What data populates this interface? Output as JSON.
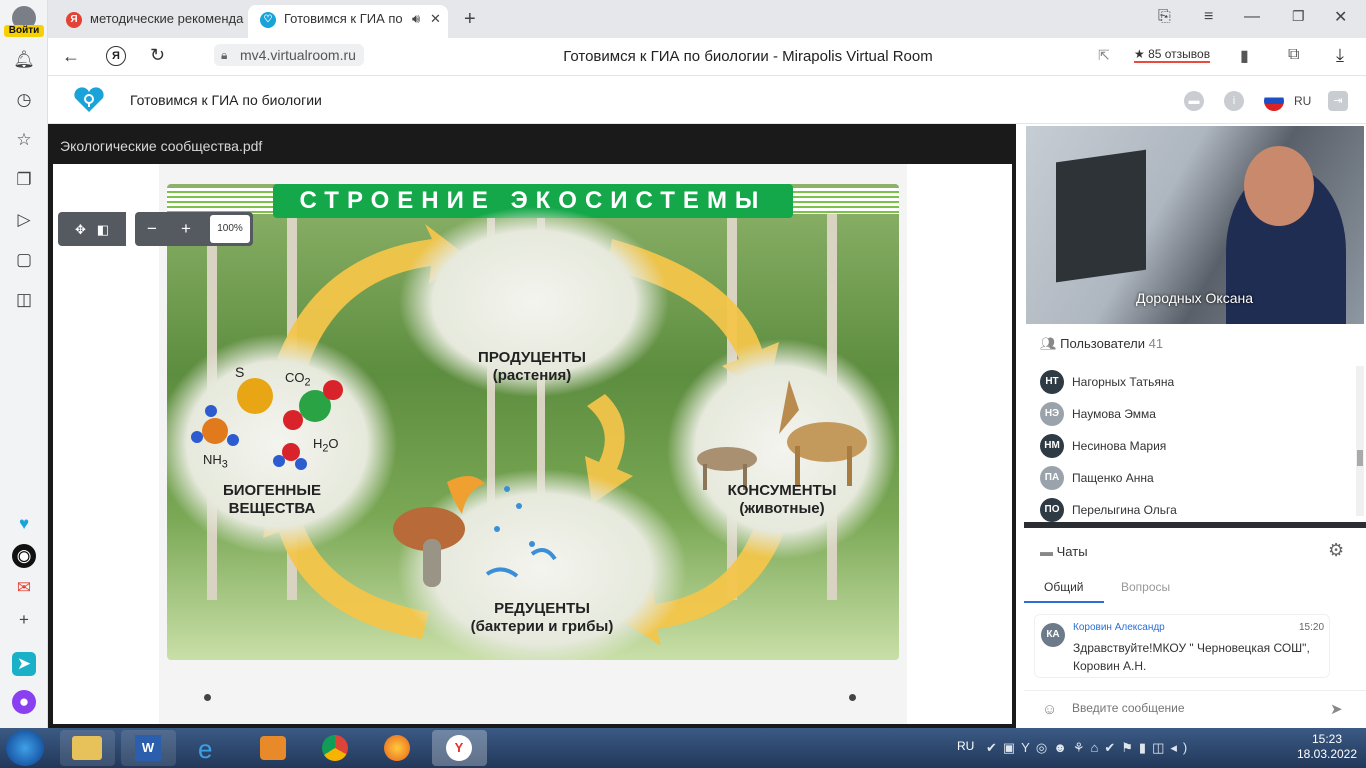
{
  "browser": {
    "login_label": "Войти",
    "tabs": [
      {
        "title": "методические рекоменда",
        "fav": "Я",
        "fav_color": "#e34234"
      },
      {
        "title": "Готовимся к ГИА по",
        "fav": "♡",
        "fav_color": "#1aa3d9"
      }
    ],
    "url": "mv4.virtualroom.ru",
    "page_title": "Готовимся к ГИА по биологии - Mirapolis Virtual Room",
    "reviews": "★ 85 отзывов"
  },
  "app": {
    "title": "Готовимся к ГИА по биологии",
    "lang": "RU"
  },
  "presentation": {
    "file_name": "Экологические сообщества.pdf",
    "zoom": "100%",
    "slide": {
      "title": "СТРОЕНИЕ ЭКОСИСТЕМЫ",
      "producers": "ПРОДУЦЕНТЫ",
      "producers_sub": "(растения)",
      "consumers": "КОНСУМЕНТЫ",
      "consumers_sub": "(животные)",
      "reducers": "РЕДУЦЕНТЫ",
      "reducers_sub": "(бактерии и грибы)",
      "biogenic": "БИОГЕННЫЕ",
      "biogenic2": "ВЕЩЕСТВА",
      "s": "S",
      "co2": "CO",
      "co2_sub": "2",
      "nh3": "NH",
      "nh3_sub": "3",
      "h2o": "H",
      "h2o_sub": "2",
      "h2o_end": "O"
    }
  },
  "video": {
    "name": "Дородных Оксана"
  },
  "users": {
    "label": "Пользователи",
    "count": "41",
    "list": [
      {
        "initials": "НТ",
        "name": "Нагорных Татьяна"
      },
      {
        "initials": "НЭ",
        "name": "Наумова Эмма"
      },
      {
        "initials": "НМ",
        "name": "Несинова Мария"
      },
      {
        "initials": "ПА",
        "name": "Пащенко Анна"
      },
      {
        "initials": "ПО",
        "name": "Перелыгина Ольга"
      }
    ]
  },
  "chats": {
    "label": "Чаты",
    "tab_general": "Общий",
    "tab_questions": "Вопросы",
    "message": {
      "initials": "КА",
      "author": "Коровин Александр",
      "time": "15:20",
      "text": "Здравствуйте!МКОУ \" Черновецкая СОШ\", Коровин А.Н."
    },
    "input_placeholder": "Введите сообщение"
  },
  "taskbar": {
    "lang": "RU",
    "time": "15:23",
    "date": "18.03.2022"
  }
}
